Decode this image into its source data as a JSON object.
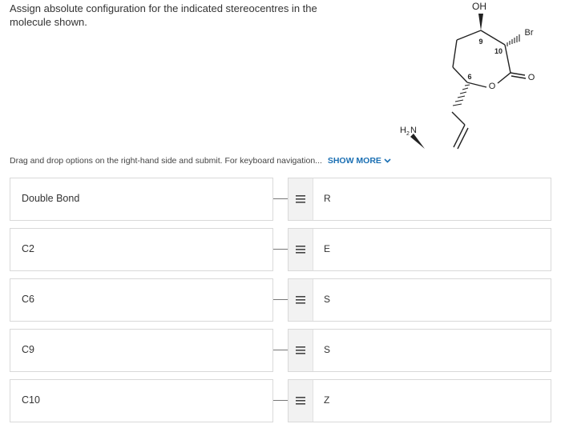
{
  "question": {
    "text": "Assign absolute configuration for the indicated stereocentres in the molecule shown."
  },
  "molecule": {
    "oh_label": "OH",
    "br_label": "Br",
    "amine_h": "H",
    "amine_sub": "2",
    "amine_n": "N",
    "ring_oxygen": "O",
    "carbonyl_oxygen": "O",
    "locant_9": "9",
    "locant_10": "10",
    "locant_6": "6"
  },
  "instructions": {
    "text": "Drag and drop options on the right-hand side and submit. For keyboard navigation...",
    "show_more": "SHOW MORE",
    "icon": "chevron-down-icon"
  },
  "pairs": [
    {
      "target": "Double Bond",
      "option": "R"
    },
    {
      "target": "C2",
      "option": "E"
    },
    {
      "target": "C6",
      "option": "S"
    },
    {
      "target": "C9",
      "option": "S"
    },
    {
      "target": "C10",
      "option": "Z"
    }
  ],
  "colors": {
    "link": "#1a6fb3",
    "border": "#d9d9d9",
    "handle_bg": "#f2f2f2"
  }
}
